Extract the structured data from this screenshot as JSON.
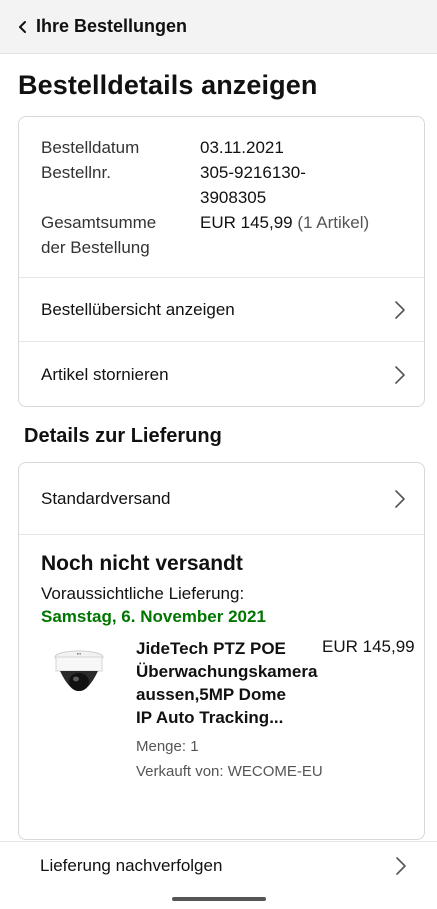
{
  "header": {
    "back_label": "Ihre Bestellungen"
  },
  "page_title": "Bestelldetails anzeigen",
  "order_info": {
    "date_label": "Bestelldatum",
    "date_value": "03.11.2021",
    "number_label": "Bestellnr.",
    "number_line1": "305-9216130-",
    "number_line2": "3908305",
    "total_label_line1": "Gesamtsumme",
    "total_label_line2": "der Bestellung",
    "total_value": "EUR 145,99",
    "total_items": "(1 Artikel)"
  },
  "actions": {
    "summary_label": "Bestellübersicht anzeigen",
    "cancel_label": "Artikel stornieren"
  },
  "delivery": {
    "section_title": "Details zur Lieferung",
    "shipping_method": "Standardversand",
    "status_title": "Noch nicht versandt",
    "expected_label": "Voraussichtliche Lieferung:",
    "expected_date": "Samstag, 6. November 2021",
    "date_color": "#007600"
  },
  "item": {
    "image_icon": "dome-camera-image",
    "name_line1": "JideTech PTZ POE",
    "name_line2": "Überwachungskamera",
    "name_line3": "aussen,5MP Dome",
    "name_line4": "IP Auto Tracking...",
    "price": "EUR 145,99",
    "quantity": "Menge: 1",
    "seller": "Verkauft von: WECOME-EU"
  },
  "track": {
    "label": "Lieferung nachverfolgen"
  }
}
